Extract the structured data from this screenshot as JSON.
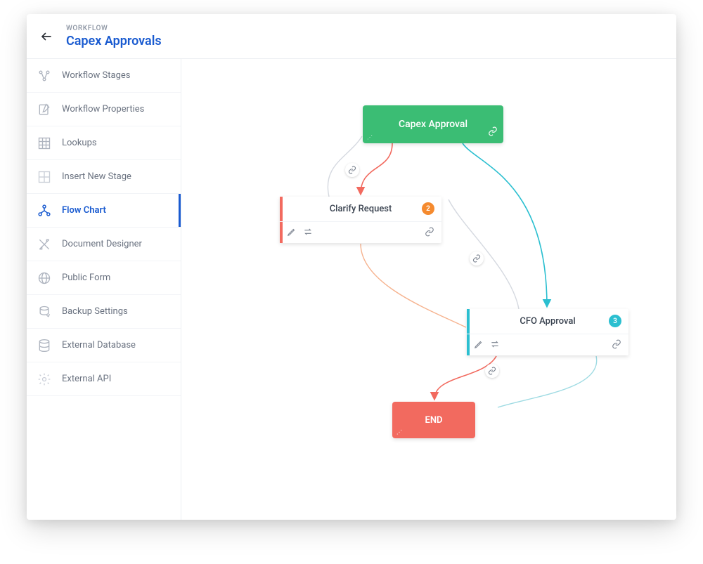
{
  "header": {
    "eyebrow": "WORKFLOW",
    "title": "Capex Approvals"
  },
  "sidebar": {
    "items": [
      {
        "label": "Workflow Stages",
        "icon": "nodes-icon"
      },
      {
        "label": "Workflow Properties",
        "icon": "edit-doc-icon"
      },
      {
        "label": "Lookups",
        "icon": "grid-icon"
      },
      {
        "label": "Insert New Stage",
        "icon": "grid-plus-icon"
      },
      {
        "label": "Flow Chart",
        "icon": "flow-icon"
      },
      {
        "label": "Document Designer",
        "icon": "design-icon"
      },
      {
        "label": "Public Form",
        "icon": "globe-icon"
      },
      {
        "label": "Backup Settings",
        "icon": "backup-icon"
      },
      {
        "label": "External Database",
        "icon": "database-icon"
      },
      {
        "label": "External API",
        "icon": "gear-icon"
      }
    ],
    "active_index": 4
  },
  "flow": {
    "start_label": "Capex Approval",
    "end_label": "END",
    "clarify": {
      "title": "Clarify Request",
      "badge": "2"
    },
    "cfo": {
      "title": "CFO Approval",
      "badge": "3"
    }
  }
}
